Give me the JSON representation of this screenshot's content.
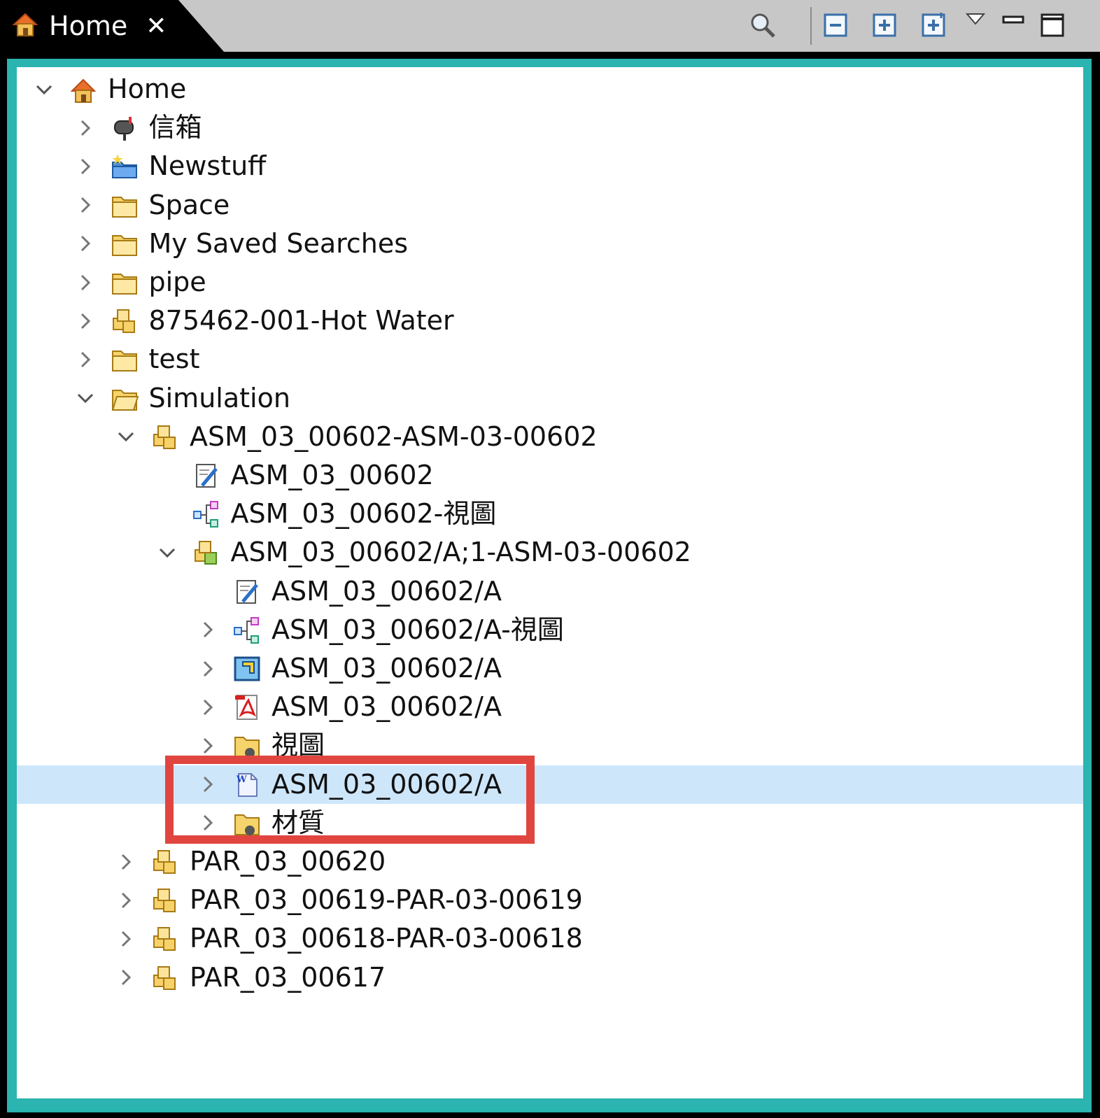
{
  "tab": {
    "title": "Home",
    "close_icon": "close-icon",
    "home_icon": "home-icon"
  },
  "toolbar": {
    "search_icon": "magnifier-icon",
    "collapse_all_icon": "collapse-all-icon",
    "expand_icon": "expand-icon",
    "expand_all_icon": "expand-all-icon",
    "view_menu_icon": "view-menu-icon",
    "minimize_icon": "minimize-icon",
    "maximize_icon": "maximize-icon"
  },
  "colors": {
    "accent_border": "#2bb4b0",
    "selection": "#cde6fa",
    "highlight_box": "#e0463f"
  },
  "tree": {
    "items": [
      {
        "label": "Home",
        "level": 0,
        "twisty": "expanded",
        "icon": "home-icon"
      },
      {
        "label": "信箱",
        "level": 1,
        "twisty": "collapsed",
        "icon": "mailbox-icon"
      },
      {
        "label": "Newstuff",
        "level": 1,
        "twisty": "collapsed",
        "icon": "newstuff-folder-icon"
      },
      {
        "label": "Space",
        "level": 1,
        "twisty": "collapsed",
        "icon": "folder-icon"
      },
      {
        "label": "My Saved Searches",
        "level": 1,
        "twisty": "collapsed",
        "icon": "folder-icon"
      },
      {
        "label": "pipe",
        "level": 1,
        "twisty": "collapsed",
        "icon": "folder-icon"
      },
      {
        "label": "875462-001-Hot Water",
        "level": 1,
        "twisty": "collapsed",
        "icon": "item-icon"
      },
      {
        "label": "test",
        "level": 1,
        "twisty": "collapsed",
        "icon": "folder-icon"
      },
      {
        "label": "Simulation",
        "level": 1,
        "twisty": "expanded",
        "icon": "open-folder-icon"
      },
      {
        "label": "ASM_03_00602-ASM-03-00602",
        "level": 2,
        "twisty": "expanded",
        "icon": "item-icon"
      },
      {
        "label": "ASM_03_00602",
        "level": 3,
        "twisty": "none",
        "icon": "form-icon"
      },
      {
        "label": "ASM_03_00602-視圖",
        "level": 3,
        "twisty": "none",
        "icon": "bom-view-icon"
      },
      {
        "label": "ASM_03_00602/A;1-ASM-03-00602",
        "level": 3,
        "twisty": "expanded",
        "icon": "item-revision-icon"
      },
      {
        "label": "ASM_03_00602/A",
        "level": 4,
        "twisty": "none",
        "icon": "form-icon"
      },
      {
        "label": "ASM_03_00602/A-視圖",
        "level": 4,
        "twisty": "collapsed",
        "icon": "bom-view-icon"
      },
      {
        "label": "ASM_03_00602/A",
        "level": 4,
        "twisty": "collapsed",
        "icon": "cad-dataset-icon"
      },
      {
        "label": "ASM_03_00602/A",
        "level": 4,
        "twisty": "collapsed",
        "icon": "pdf-icon"
      },
      {
        "label": "視圖",
        "level": 4,
        "twisty": "collapsed",
        "icon": "pseudo-folder-icon",
        "partially_hidden": true
      },
      {
        "label": "ASM_03_00602/A",
        "level": 4,
        "twisty": "collapsed",
        "icon": "word-document-icon",
        "selected": true
      },
      {
        "label": "材質",
        "level": 4,
        "twisty": "collapsed",
        "icon": "pseudo-folder-icon",
        "partially_hidden": true
      },
      {
        "label": "PAR_03_00620",
        "level": 2,
        "twisty": "collapsed",
        "icon": "item-icon"
      },
      {
        "label": "PAR_03_00619-PAR-03-00619",
        "level": 2,
        "twisty": "collapsed",
        "icon": "item-icon"
      },
      {
        "label": "PAR_03_00618-PAR-03-00618",
        "level": 2,
        "twisty": "collapsed",
        "icon": "item-icon"
      },
      {
        "label": "PAR_03_00617",
        "level": 2,
        "twisty": "collapsed",
        "icon": "item-icon"
      }
    ]
  }
}
